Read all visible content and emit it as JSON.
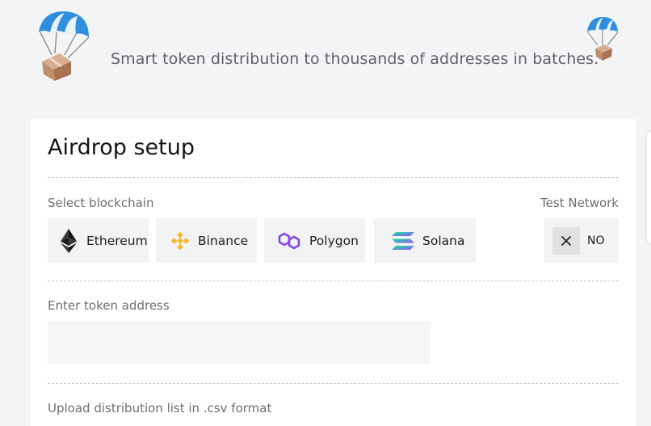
{
  "header": {
    "tagline": "Smart token distribution to thousands of addresses in batches.",
    "logo_icon": "parachute-box-icon"
  },
  "airdrop": {
    "title": "Airdrop setup",
    "select_blockchain_label": "Select blockchain",
    "test_network_label": "Test Network",
    "test_network_value": "NO",
    "chains": [
      {
        "label": "Ethereum",
        "icon": "ethereum-icon",
        "color": "#343434"
      },
      {
        "label": "Binance",
        "icon": "binance-icon",
        "color": "#f3ba2f"
      },
      {
        "label": "Polygon",
        "icon": "polygon-icon",
        "color": "#8247e5"
      },
      {
        "label": "Solana",
        "icon": "solana-icon",
        "color": "#9945ff"
      }
    ],
    "token_address_label": "Enter token address",
    "token_address_value": "",
    "upload_label": "Upload distribution list in .csv format"
  },
  "colors": {
    "background": "#f2f4f5",
    "card": "#ffffff",
    "button_bg": "#f1f3f4",
    "divider": "#b9cbd6"
  }
}
